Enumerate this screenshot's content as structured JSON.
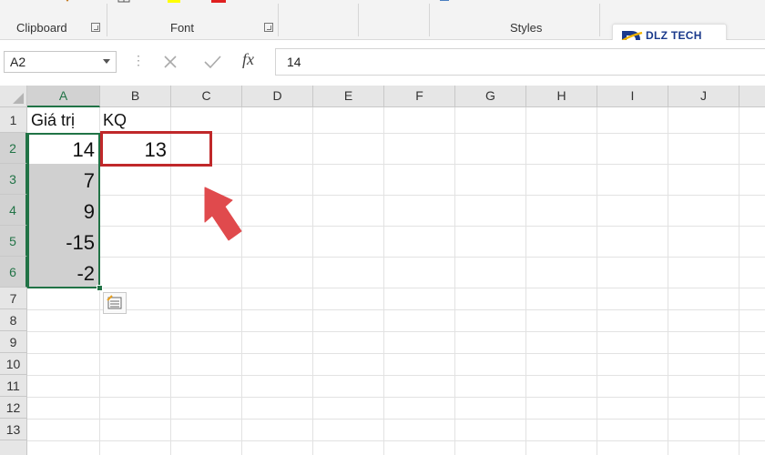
{
  "ribbon": {
    "groups": [
      {
        "label": "Clipboard"
      },
      {
        "label": "Font"
      },
      {
        "label": "Styles"
      }
    ]
  },
  "logo": {
    "text": "DLZ TECH"
  },
  "formula_bar": {
    "name_box": "A2",
    "value": "14",
    "fx_label": "fx"
  },
  "columns": [
    "A",
    "B",
    "C",
    "D",
    "E",
    "F",
    "G",
    "H",
    "I",
    "J"
  ],
  "rows": [
    "1",
    "2",
    "3",
    "4",
    "5",
    "6",
    "7",
    "8",
    "9",
    "10",
    "11",
    "12",
    "13"
  ],
  "cells": {
    "A1": "Giá trị",
    "B1": "KQ",
    "A2": "14",
    "B2": "13",
    "A3": "7",
    "A4": "9",
    "A5": "-15",
    "A6": "-2"
  },
  "colors": {
    "accent": "#217346",
    "highlight": "#c0282a",
    "arrow": "#e04a4d"
  }
}
